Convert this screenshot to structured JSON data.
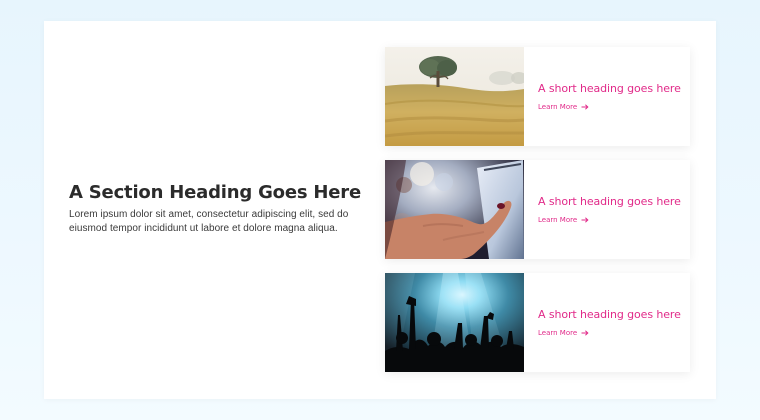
{
  "section": {
    "heading": "A Section Heading Goes Here",
    "body": "Lorem ipsum dolor sit amet, consectetur adipiscing elit, sed do eiusmod tempor incididunt ut labore et dolore magna aliqua."
  },
  "cards": [
    {
      "image_icon": "field-tree-image",
      "heading": "A short heading goes here",
      "link_label": "Learn More"
    },
    {
      "image_icon": "tablet-hand-image",
      "heading": "A short heading goes here",
      "link_label": "Learn More"
    },
    {
      "image_icon": "concert-crowd-image",
      "heading": "A short heading goes here",
      "link_label": "Learn More"
    }
  ],
  "colors": {
    "accent": "#e12a89",
    "heading": "#2b2b2b",
    "body_text": "#3a3a3a",
    "page_background": "#eaf7ff",
    "panel": "#ffffff"
  },
  "icons": {
    "link_arrow": "arrow-right-icon"
  }
}
